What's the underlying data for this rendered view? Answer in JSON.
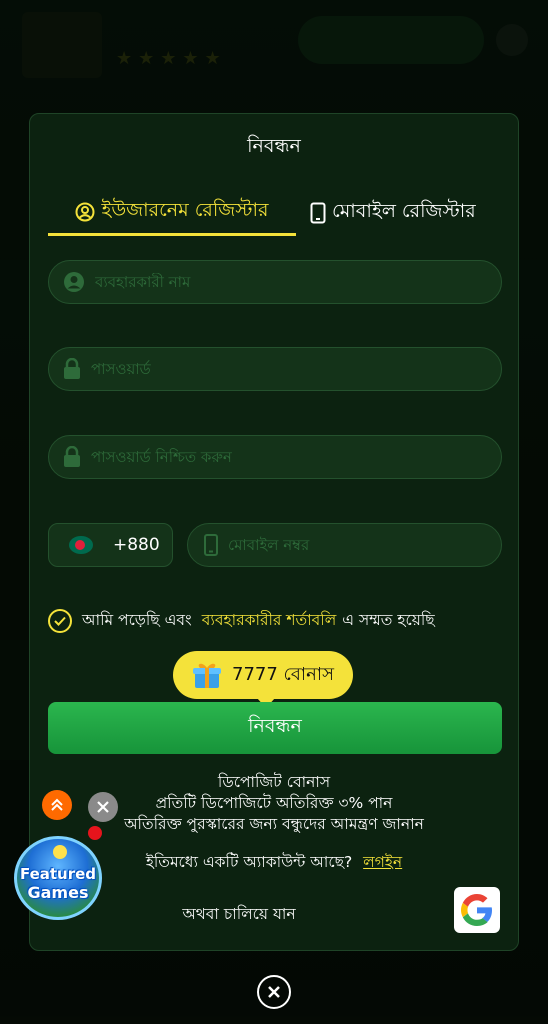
{
  "modal": {
    "title": "নিবন্ধন",
    "tabs": [
      {
        "label": "ইউজারনেম রেজিস্টার",
        "active": true
      },
      {
        "label": "মোবাইল রেজিস্টার",
        "active": false
      }
    ],
    "fields": {
      "username_placeholder": "ব্যবহারকারী নাম",
      "password_placeholder": "পাসওয়ার্ড",
      "confirm_password_placeholder": "পাসওয়ার্ড নিশ্চিত করুন",
      "country_code": "+880",
      "mobile_placeholder": "মোবাইল নম্বর"
    },
    "terms": {
      "prefix": "আমি পড়েছি এবং",
      "link": "ব্যবহারকারীর শর্তাবলি",
      "suffix": "এ সম্মত হয়েছি"
    },
    "bonus_badge": "7777 বোনাস",
    "submit_label": "নিবন্ধন",
    "info_lines": [
      "ডিপোজিট বোনাস",
      "প্রতিটি ডিপোজিটে অতিরিক্ত ৩% পান",
      "অতিরিক্ত পুরস্কারের জন্য বন্ধুদের আমন্ত্রণ জানান"
    ],
    "login_prompt": "ইতিমধ্যে একটি অ্যাকাউন্ট আছে?",
    "login_link": "লগইন",
    "or_continue": "অথবা চালিয়ে যান"
  },
  "featured_badge": {
    "line1": "Featured",
    "line2": "Games"
  },
  "colors": {
    "accent_yellow": "#f4e23a",
    "primary_green": "#1fa544",
    "modal_bg": "#0c2210",
    "field_bg": "#143319"
  },
  "icons": [
    "user-circle-icon",
    "mobile-phone-icon",
    "lock-icon",
    "checkmark-icon",
    "gift-icon",
    "google-icon",
    "chevron-up-icon",
    "close-icon"
  ]
}
